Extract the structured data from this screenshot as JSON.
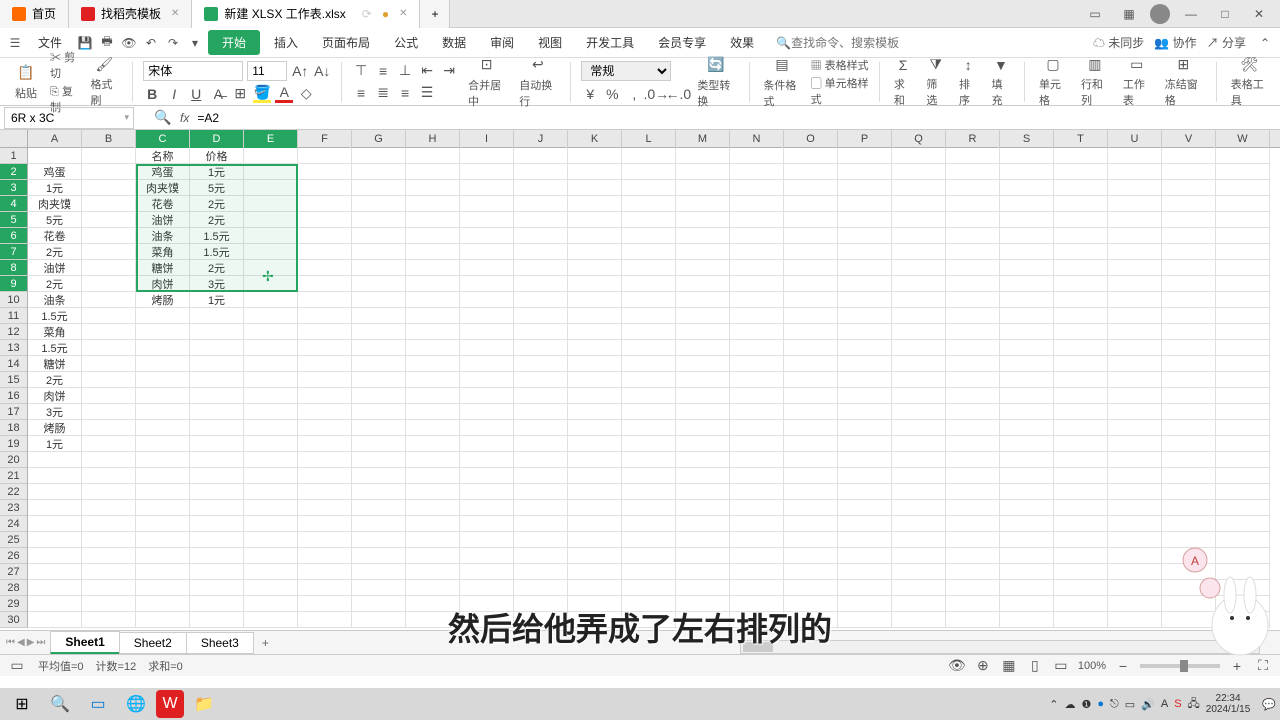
{
  "tabs": {
    "home": "首页",
    "template": "找稻壳模板",
    "file": "新建 XLSX 工作表.xlsx"
  },
  "menu": {
    "file": "文件",
    "start": "开始",
    "insert": "插入",
    "layout": "页面布局",
    "formula": "公式",
    "data": "数据",
    "review": "审阅",
    "view": "视图",
    "dev": "开发工具",
    "member": "会员专享",
    "effect": "效果",
    "search_placeholder": "查找命令、搜索模板"
  },
  "menuright": {
    "unsync": "未同步",
    "coop": "协作",
    "share": "分享"
  },
  "ribbon": {
    "paste": "粘贴",
    "cut": "剪切",
    "copy": "复制",
    "format_painter": "格式刷",
    "font": "宋体",
    "size": "11",
    "merge": "合并居中",
    "wrap": "自动换行",
    "general": "常规",
    "type_convert": "类型转换",
    "cond_format": "条件格式",
    "table_style": "表格样式",
    "cell_style": "单元格样式",
    "sum": "求和",
    "filter": "筛选",
    "sort": "排序",
    "fill": "填充",
    "cell": "单元格",
    "rowcol": "行和列",
    "sheet": "工作表",
    "freeze": "冻结窗格",
    "macro": "表格工具"
  },
  "namebox": "6R x 3C",
  "formula": "=A2",
  "columns": [
    "A",
    "B",
    "C",
    "D",
    "E",
    "F",
    "G",
    "H",
    "I",
    "J",
    "K",
    "L",
    "M",
    "N",
    "O",
    "P",
    "Q",
    "R",
    "S",
    "T",
    "U",
    "V",
    "W"
  ],
  "colA": [
    "",
    "鸡蛋",
    "1元",
    "肉夹馍",
    "5元",
    "花卷",
    "2元",
    "油饼",
    "2元",
    "油条",
    "1.5元",
    "菜角",
    "1.5元",
    "糖饼",
    "2元",
    "肉饼",
    "3元",
    "烤肠",
    "1元"
  ],
  "colC_header": "名称",
  "colD_header": "价格",
  "tableC": [
    "鸡蛋",
    "肉夹馍",
    "花卷",
    "油饼",
    "油条",
    "菜角",
    "糖饼",
    "肉饼",
    "烤肠"
  ],
  "tableD": [
    "1元",
    "5元",
    "2元",
    "2元",
    "1.5元",
    "1.5元",
    "2元",
    "3元",
    "1元"
  ],
  "sheets": {
    "s1": "Sheet1",
    "s2": "Sheet2",
    "s3": "Sheet3"
  },
  "status": {
    "avg": "平均值=0",
    "count": "计数=12",
    "sum": "求和=0",
    "zoom": "100%"
  },
  "clock": {
    "time": "22:34",
    "date": "2024/1/15"
  },
  "subtitle": "然后给他弄成了左右排列的"
}
